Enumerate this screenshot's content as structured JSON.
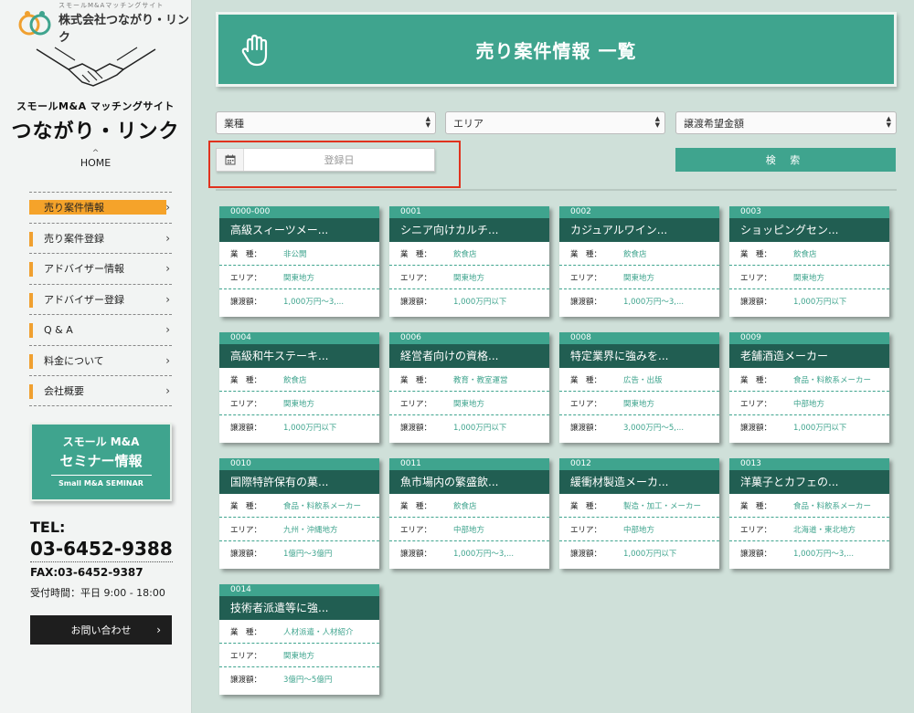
{
  "logo": {
    "small": "スモールM&Aマッチングサイト",
    "company": "株式会社つながり・リンク"
  },
  "site": {
    "subtitle": "スモールM&A マッチングサイト",
    "name": "つながり・リンク"
  },
  "home": {
    "label": "HOME"
  },
  "menu": [
    {
      "label": "売り案件情報",
      "active": true
    },
    {
      "label": "売り案件登録",
      "active": false
    },
    {
      "label": "アドバイザー情報",
      "active": false
    },
    {
      "label": "アドバイザー登録",
      "active": false
    },
    {
      "label": "Q & A",
      "active": false
    },
    {
      "label": "料金について",
      "active": false
    },
    {
      "label": "会社概要",
      "active": false
    }
  ],
  "seminar": {
    "line1": "スモール M&A",
    "line2": "セミナー情報",
    "line3": "Small M&A SEMINAR"
  },
  "contact": {
    "tel_label": "TEL:",
    "tel": "03-6452-9388",
    "fax": "FAX:03-6452-9387",
    "hours": "受付時間：平日 9:00 - 18:00",
    "button": "お問い合わせ"
  },
  "header": {
    "title": "売り案件情報 一覧"
  },
  "filters": {
    "industry": "業種",
    "area": "エリア",
    "price": "譲渡希望金額",
    "date_placeholder": "登録日",
    "search": "検 索"
  },
  "labels": {
    "industry": "業　種：",
    "area": "エリア：",
    "price": "譲渡額："
  },
  "colors": {
    "accent": "#3fa48e",
    "dark": "#215e52",
    "highlight": "#f5a32a",
    "annotation": "#e0321e"
  },
  "cards": [
    {
      "id": "0000-000",
      "name": "高級スィーツメー...",
      "industry": "非公開",
      "area": "関東地方",
      "price": "1,000万円～3,..."
    },
    {
      "id": "0001",
      "name": "シニア向けカルチ...",
      "industry": "飲食店",
      "area": "関東地方",
      "price": "1,000万円以下"
    },
    {
      "id": "0002",
      "name": "カジュアルワイン...",
      "industry": "飲食店",
      "area": "関東地方",
      "price": "1,000万円～3,..."
    },
    {
      "id": "0003",
      "name": "ショッピングセン...",
      "industry": "飲食店",
      "area": "関東地方",
      "price": "1,000万円以下"
    },
    {
      "id": "0004",
      "name": "高級和牛ステーキ...",
      "industry": "飲食店",
      "area": "関東地方",
      "price": "1,000万円以下"
    },
    {
      "id": "0006",
      "name": "経営者向けの資格...",
      "industry": "教育・教室運営",
      "area": "関東地方",
      "price": "1,000万円以下"
    },
    {
      "id": "0008",
      "name": "特定業界に強みを...",
      "industry": "広告・出版",
      "area": "関東地方",
      "price": "3,000万円～5,..."
    },
    {
      "id": "0009",
      "name": "老舗酒造メーカー",
      "industry": "食品・料飲系メーカー",
      "area": "中部地方",
      "price": "1,000万円以下"
    },
    {
      "id": "0010",
      "name": "国際特許保有の菓...",
      "industry": "食品・料飲系メーカー",
      "area": "九州・沖縄地方",
      "price": "1億円～3億円"
    },
    {
      "id": "0011",
      "name": "魚市場内の繁盛飲...",
      "industry": "飲食店",
      "area": "中部地方",
      "price": "1,000万円～3,..."
    },
    {
      "id": "0012",
      "name": "緩衝材製造メーカ...",
      "industry": "製造・加工・メーカー",
      "area": "中部地方",
      "price": "1,000万円以下"
    },
    {
      "id": "0013",
      "name": "洋菓子とカフェの...",
      "industry": "食品・料飲系メーカー",
      "area": "北海道・東北地方",
      "price": "1,000万円～3,..."
    },
    {
      "id": "0014",
      "name": "技術者派遣等に強...",
      "industry": "人材派遣・人材紹介",
      "area": "関東地方",
      "price": "3億円～5億円"
    }
  ]
}
